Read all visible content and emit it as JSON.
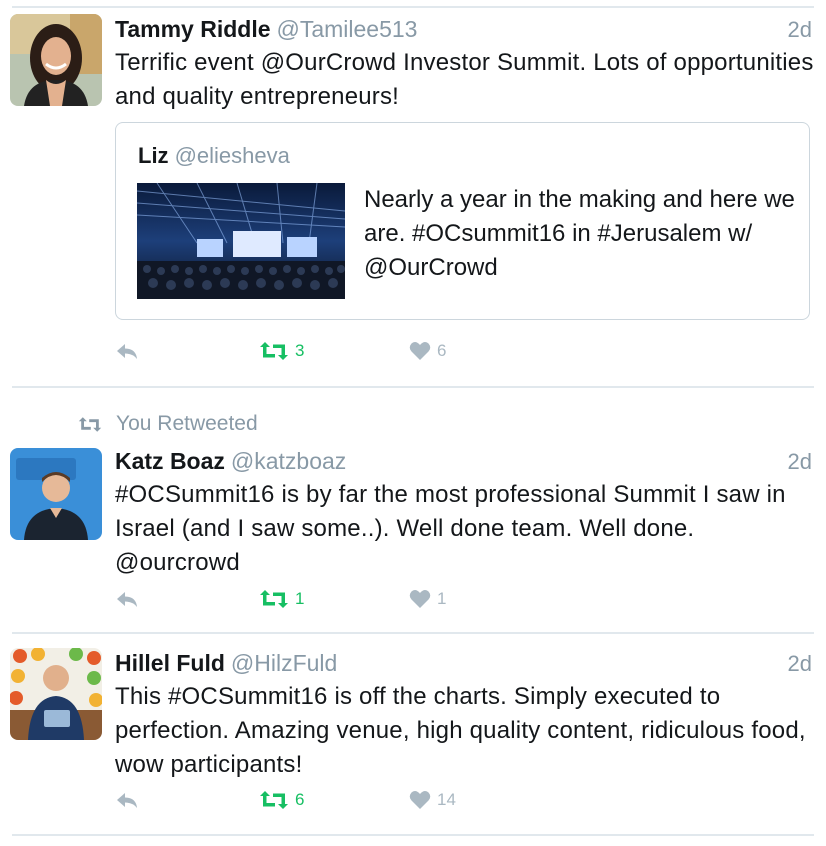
{
  "tweets": [
    {
      "name": "Tammy Riddle",
      "handle": "@Tamilee513",
      "time": "2d",
      "text": "Terrific event @OurCrowd  Investor Summit. Lots of opportunities and quality entrepreneurs!",
      "quote": {
        "name": "Liz",
        "handle": "@eliesheva",
        "text": "Nearly a year in the making and here we are. #OCsummit16 in #Jerusalem w/ @OurCrowd"
      },
      "retweets": "3",
      "likes": "6"
    },
    {
      "context": "You Retweeted",
      "name": "Katz Boaz",
      "handle": "@katzboaz",
      "time": "2d",
      "text": "#OCSummit16 is by far the most professional Summit I saw in Israel (and I saw some..). Well done team.  Well done. @ourcrowd",
      "retweets": "1",
      "likes": "1"
    },
    {
      "name": "Hillel Fuld",
      "handle": "@HilzFuld",
      "time": "2d",
      "text": "This #OCSummit16 is off the charts. Simply executed to perfection. Amazing venue, high quality content, ridiculous food, wow participants!",
      "retweets": "6",
      "likes": "14"
    }
  ],
  "icons": {
    "reply": "reply-icon",
    "retweet": "retweet-icon",
    "like": "heart-icon"
  },
  "colors": {
    "retweet": "#17bf63",
    "muted": "#8899a6",
    "icon_gray": "#aab8c2",
    "divider": "#e1e8ed"
  }
}
